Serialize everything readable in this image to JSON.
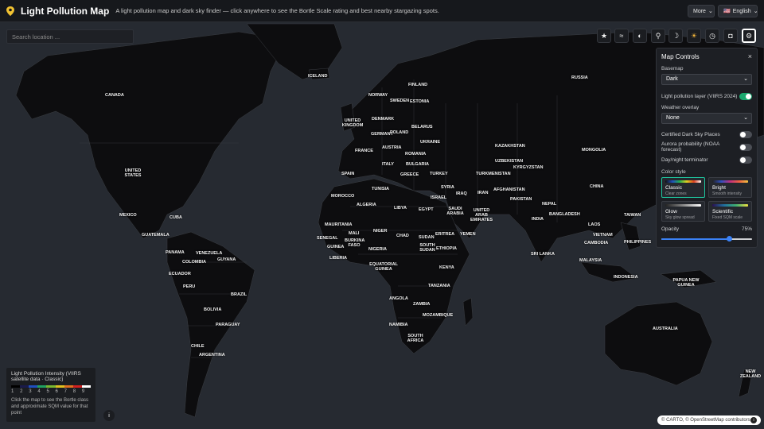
{
  "header": {
    "title": "Light Pollution Map",
    "subtitle": "A light pollution map and dark sky finder — click anywhere to see the Bortle Scale rating and best nearby stargazing spots.",
    "more_label": "More",
    "language_label": "English",
    "language_flag": "🇺🇸"
  },
  "search": {
    "placeholder": "Search location ..."
  },
  "toolbar": {
    "icons": [
      "star-icon",
      "waves-icon",
      "contrast-icon",
      "telescope-icon",
      "moon-icon",
      "sun-icon",
      "clock-icon",
      "camera-icon",
      "gear-icon"
    ],
    "glyphs": [
      "★",
      "≈",
      "◐",
      "⚲",
      "☽",
      "☀",
      "◷",
      "◘",
      "⚙"
    ]
  },
  "panel": {
    "title": "Map Controls",
    "close": "×",
    "basemap_label": "Basemap",
    "basemap_value": "Dark",
    "lp_layer_label": "Light pollution layer (VIIRS 2024)",
    "lp_layer_on": true,
    "weather_label": "Weather overlay",
    "weather_value": "None",
    "dark_sky_label": "Certified Dark Sky Places",
    "aurora_label": "Aurora probability (NOAA forecast)",
    "terminator_label": "Day/night terminator",
    "color_style_label": "Color style",
    "styles": [
      {
        "name": "Classic",
        "desc": "Clear zones"
      },
      {
        "name": "Bright",
        "desc": "Smooth intensity"
      },
      {
        "name": "Glow",
        "desc": "Sky glow spread"
      },
      {
        "name": "Scientific",
        "desc": "Fixed SQM scale"
      }
    ],
    "opacity_label": "Opacity",
    "opacity_value": "75%",
    "opacity_fraction": 0.75
  },
  "legend": {
    "title": "Light Pollution Intensity (VIIRS satellite data · Classic)",
    "scale": [
      "1",
      "2",
      "3",
      "4",
      "5",
      "6",
      "7",
      "8",
      "9"
    ],
    "note": "Click the map to see the Bortle class and approximate SQM value for that point"
  },
  "attribution": "© CARTO, © OpenStreetMap contributors",
  "map_labels": [
    "ICELAND",
    "FINLAND",
    "RUSSIA",
    "CANADA",
    "NORWAY",
    "SWEDEN",
    "ESTONIA",
    "DENMARK",
    "UNITED KINGDOM",
    "BELARUS",
    "GERMANY",
    "POLAND",
    "UKRAINE",
    "KAZAKHSTAN",
    "MONGOLIA",
    "FRANCE",
    "AUSTRIA",
    "ROMANIA",
    "ITALY",
    "BULGARIA",
    "UNITED STATES",
    "SPAIN",
    "GREECE",
    "TURKEY",
    "UZBEKISTAN",
    "TURKMENISTAN",
    "KYRGYZSTAN",
    "CHINA",
    "TUNISIA",
    "SYRIA",
    "MOROCCO",
    "IRAQ",
    "IRAN",
    "AFGHANISTAN",
    "ISRAEL",
    "ALGERIA",
    "LIBYA",
    "EGYPT",
    "PAKISTAN",
    "NEPAL",
    "TAIWAN",
    "MEXICO",
    "CUBA",
    "SAUDI ARABIA",
    "UNITED ARAB EMIRATES",
    "INDIA",
    "BANGLADESH",
    "MAURITANIA",
    "MALI",
    "NIGER",
    "CHAD",
    "SUDAN",
    "ERITREA",
    "YEMEN",
    "LAOS",
    "GUATEMALA",
    "SENEGAL",
    "BURKINA FASO",
    "VIETNAM",
    "PHILIPPINES",
    "GUINEA",
    "NIGERIA",
    "ETHIOPIA",
    "SOUTH SUDAN",
    "CAMBODIA",
    "PANAMA",
    "VENEZUELA",
    "LIBERIA",
    "SRI LANKA",
    "COLOMBIA",
    "GUYANA",
    "EQUATORIAL GUINEA",
    "KENYA",
    "MALAYSIA",
    "ECUADOR",
    "INDONESIA",
    "PAPUA NEW GUINEA",
    "PERU",
    "TANZANIA",
    "BRAZIL",
    "ANGOLA",
    "ZAMBIA",
    "BOLIVIA",
    "MOZAMBIQUE",
    "NAMIBIA",
    "PARAGUAY",
    "AUSTRALIA",
    "SOUTH AFRICA",
    "CHILE",
    "ARGENTINA",
    "NEW ZEALAND"
  ]
}
